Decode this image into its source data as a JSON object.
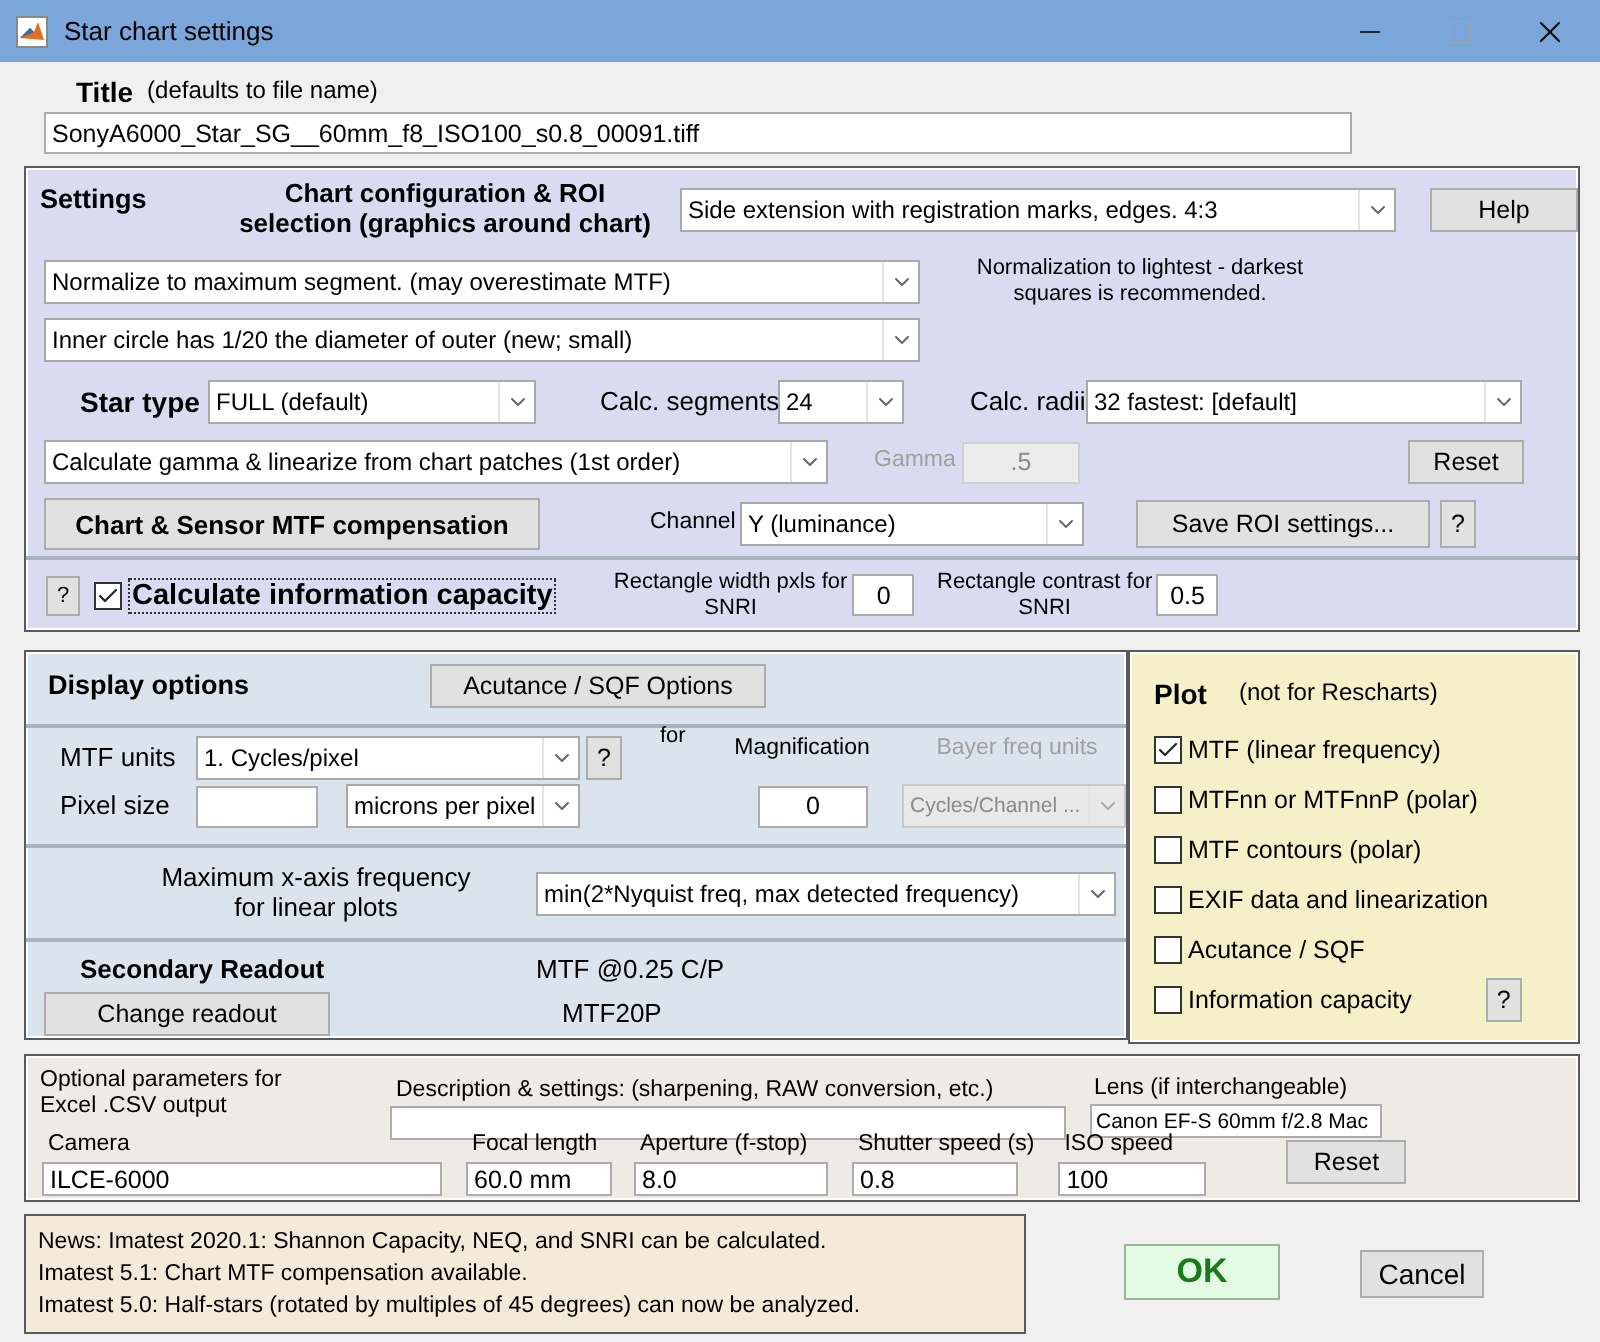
{
  "window": {
    "title": "Star chart settings"
  },
  "title_section": {
    "label": "Title",
    "hint": "(defaults to file name)",
    "value": "SonyA6000_Star_SG__60mm_f8_ISO100_s0.8_00091.tiff"
  },
  "settings": {
    "heading": "Settings",
    "chart_config_label": "Chart configuration & ROI selection (graphics around chart)",
    "chart_config_value": "Side extension with registration marks, edges. 4:3",
    "help_button": "Help",
    "normalize_value": "Normalize to maximum segment.    (may overestimate MTF)",
    "normalization_note": "Normalization to lightest - darkest squares is recommended.",
    "inner_circle_value": "Inner circle has 1/20 the diameter of outer (new; small)",
    "star_type_label": "Star type",
    "star_type_value": "FULL (default)",
    "segments_label": "Calc. segments",
    "segments_value": "24",
    "radii_label": "Calc. radii",
    "radii_value": "32    fastest:  [default]",
    "gamma_mode_value": "Calculate gamma & linearize from chart patches (1st order)",
    "gamma": {
      "label": "Gamma",
      "value": ".5",
      "disabled": true
    },
    "reset_button": "Reset",
    "mtf_comp_button": "Chart & Sensor MTF compensation",
    "channel_label": "Channel",
    "channel_value": "Y (luminance)",
    "save_roi_button": "Save ROI settings...",
    "help_mark": "?"
  },
  "info_capacity": {
    "help_mark": "?",
    "label": "Calculate information capacity",
    "checked": true,
    "rect_width_label": "Rectangle width pxls for SNRI",
    "rect_width_value": "0",
    "rect_contrast_label": "Rectangle contrast for SNRI",
    "rect_contrast_value": "0.5"
  },
  "display": {
    "heading": "Display options",
    "acutance_button": "Acutance / SQF Options",
    "mtf_units_label": "MTF units",
    "mtf_units_value": "1. Cycles/pixel",
    "help_mark": "?",
    "for_label": "for",
    "magnification_label": "Magnification",
    "magnification_value": "0",
    "bayer": {
      "label": "Bayer freq units",
      "value": "Cycles/Channel ...",
      "disabled": true
    },
    "pixel_size_label": "Pixel size",
    "pixel_size_unit": "microns per pixel",
    "max_freq_label": "Maximum x-axis frequency for linear plots",
    "max_freq_value": "min(2*Nyquist freq, max detected frequency)",
    "readout_heading": "Secondary Readout",
    "readout_primary": "MTF @0.25 C/P",
    "change_readout_button": "Change readout",
    "readout_secondary": "MTF20P"
  },
  "plot": {
    "heading": "Plot",
    "note": "(not for Rescharts)",
    "help_mark": "?",
    "items": [
      {
        "label": "MTF (linear frequency)",
        "checked": true
      },
      {
        "label": "MTFnn or MTFnnP (polar)",
        "checked": false
      },
      {
        "label": "MTF contours (polar)",
        "checked": false
      },
      {
        "label": "EXIF data and linearization",
        "checked": false
      },
      {
        "label": "Acutance / SQF",
        "checked": false
      },
      {
        "label": "Information capacity",
        "checked": false
      }
    ]
  },
  "optional": {
    "heading": "Optional parameters for Excel .CSV output",
    "description_label": "Description & settings:  (sharpening, RAW conversion, etc.)",
    "lens_label": "Lens (if interchangeable)",
    "lens_value": "Canon EF-S 60mm f/2.8 Mac",
    "reset_button": "Reset",
    "fields": [
      {
        "label": "Camera",
        "value": "ILCE-6000"
      },
      {
        "label": "Focal length",
        "value": "60.0 mm"
      },
      {
        "label": "Aperture (f-stop)",
        "value": "8.0"
      },
      {
        "label": "Shutter speed (s)",
        "value": "0.8"
      },
      {
        "label": "ISO speed",
        "value": "100"
      }
    ]
  },
  "news": [
    "News:  Imatest 2020.1:  Shannon Capacity, NEQ, and SNRI can be calculated.",
    "Imatest 5.1:  Chart MTF compensation available.",
    "Imatest 5.0:  Half-stars (rotated by multiples of 45 degrees) can now be analyzed."
  ],
  "ok_button": "OK",
  "cancel_button": "Cancel"
}
